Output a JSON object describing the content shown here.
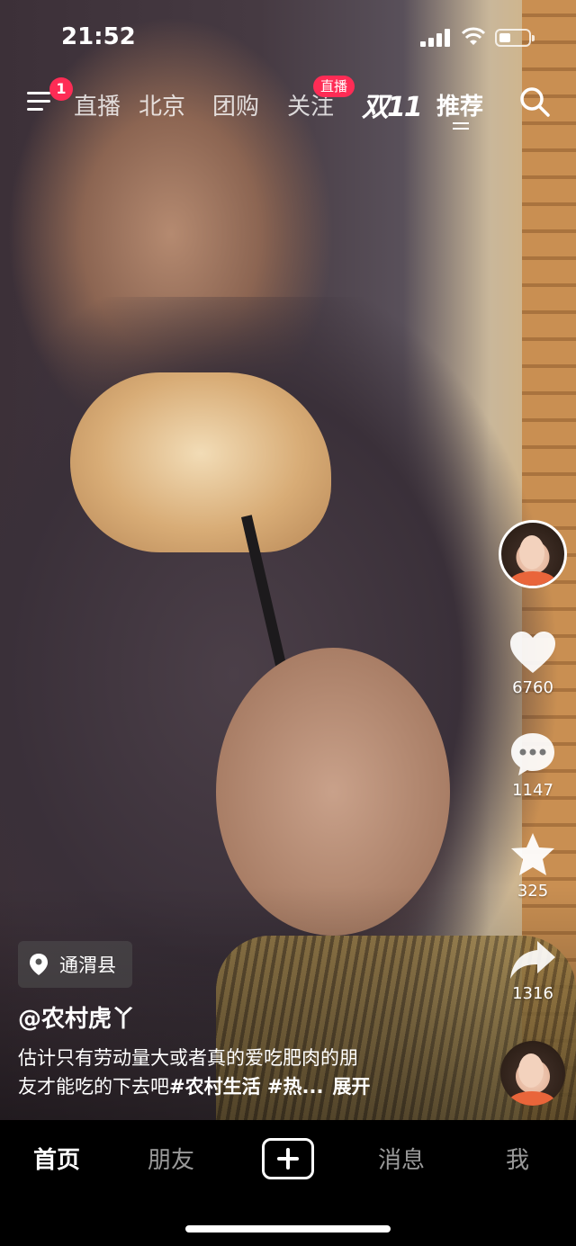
{
  "status": {
    "time": "21:52"
  },
  "nav": {
    "notification_count": "1",
    "tabs": [
      "直播",
      "北京",
      "团购",
      "关注",
      "推荐"
    ],
    "live_badge": "直播",
    "double11": "双11",
    "active_tab": "推荐"
  },
  "rail": {
    "likes": "6760",
    "comments": "1147",
    "favorites": "325",
    "shares": "1316"
  },
  "video": {
    "location": "通渭县",
    "author": "@农村虎丫",
    "description_line1": "估计只有劳动量大或者真的爱吃肥肉的朋",
    "description_line2": "友才能吃的下去吧",
    "tags": "#农村生活 #热...",
    "expand": "展开"
  },
  "bottom": {
    "home": "首页",
    "friends": "朋友",
    "messages": "消息",
    "me": "我"
  },
  "colors": {
    "accent": "#fe2c55",
    "background": "#000000"
  }
}
